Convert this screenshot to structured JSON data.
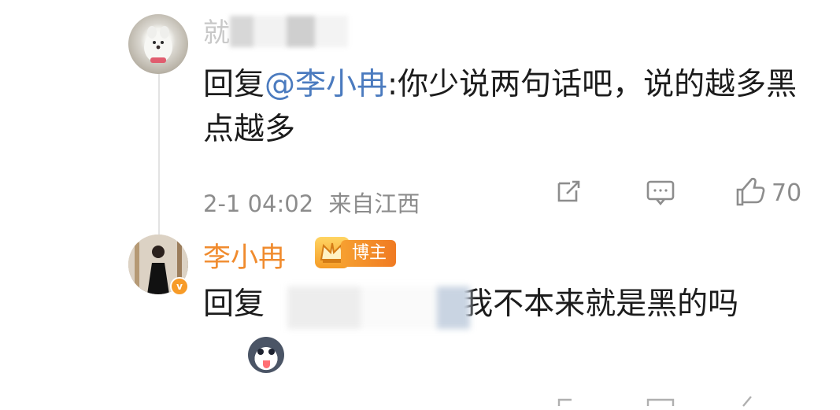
{
  "comment1": {
    "username_visible": "就",
    "text_prefix": "回复",
    "mention": "@李小冉",
    "text_body": ":你少说两句话吧，说的越多黑点越多",
    "timestamp": "2-1 04:02",
    "source": "来自江西",
    "like_count": "70",
    "icons": [
      "share-icon",
      "comment-icon",
      "like-icon"
    ]
  },
  "comment2": {
    "username": "李小冉",
    "badge_label": "博主",
    "verified_mark": "v",
    "text_prefix": "回复",
    "text_body": ":我不本来就是黑的吗",
    "emoji": "husky-emoji"
  }
}
